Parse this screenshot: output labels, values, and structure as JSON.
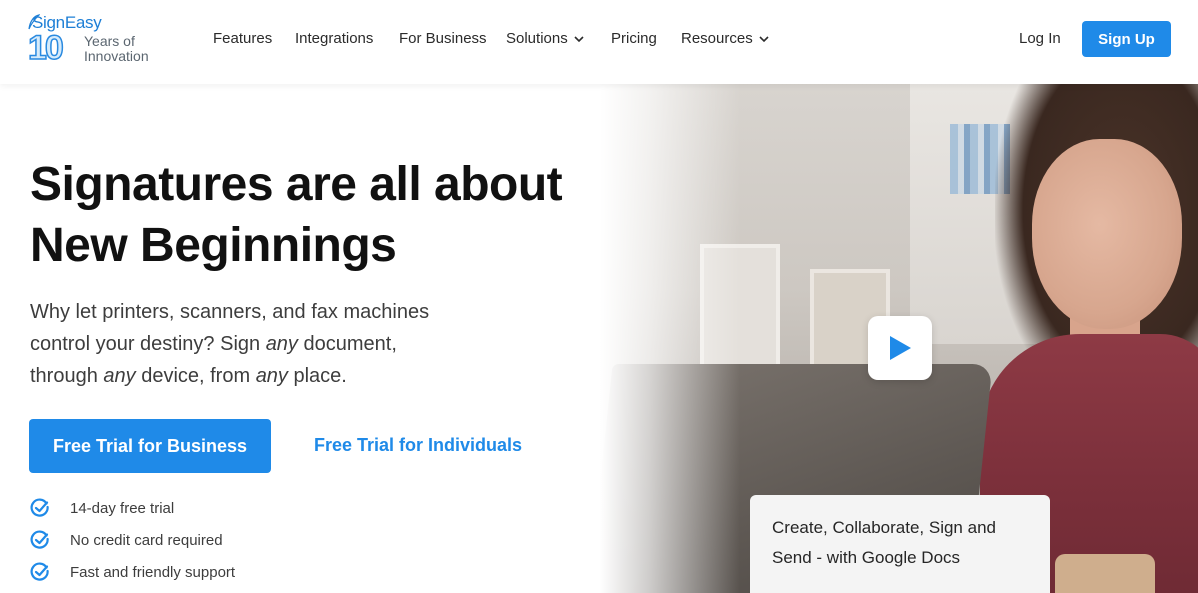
{
  "brand": {
    "name": "SignEasy",
    "anniversary_number": "10",
    "anniversary_line1": "Years of",
    "anniversary_line2": "Innovation"
  },
  "nav": {
    "items": [
      {
        "label": "Features",
        "has_dropdown": false
      },
      {
        "label": "Integrations",
        "has_dropdown": false
      },
      {
        "label": "For Business",
        "has_dropdown": false
      },
      {
        "label": "Solutions",
        "has_dropdown": true
      },
      {
        "label": "Pricing",
        "has_dropdown": false
      },
      {
        "label": "Resources",
        "has_dropdown": true
      }
    ],
    "login_label": "Log In",
    "signup_label": "Sign Up"
  },
  "hero": {
    "title_line1": "Signatures are all about",
    "title_line2": "New Beginnings",
    "sub_part1": "Why let printers, scanners, and fax machines control your destiny? Sign ",
    "sub_em1": "any",
    "sub_part2": " document, through ",
    "sub_em2": "any",
    "sub_part3": " device, from ",
    "sub_em3": "any",
    "sub_part4": " place.",
    "primary_cta": "Free Trial for Business",
    "secondary_cta": "Free Trial for Individuals",
    "checks": [
      "14-day free trial",
      "No credit card required",
      "Fast and friendly support"
    ]
  },
  "video": {
    "caption_line1": "Create, Collaborate, Sign and",
    "caption_line2": "Send - with Google Docs",
    "play_icon": "play-icon"
  },
  "colors": {
    "accent": "#1f8ae8",
    "text": "#111111",
    "muted": "#3d3d3d"
  }
}
